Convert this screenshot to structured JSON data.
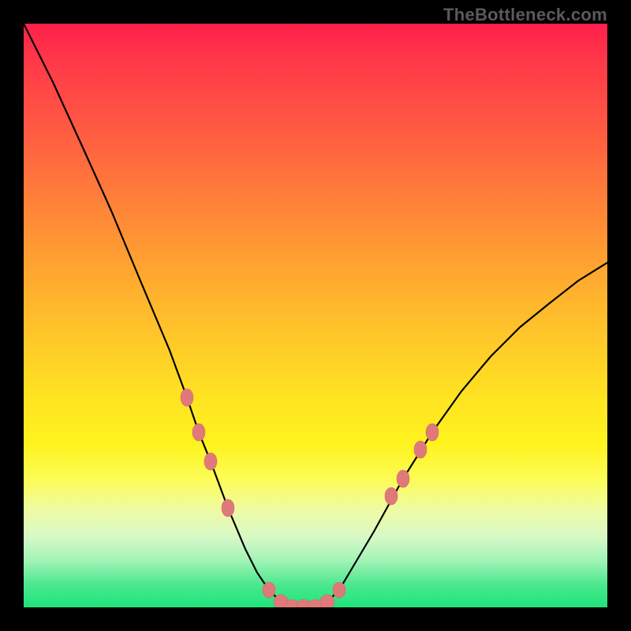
{
  "watermark": {
    "text": "TheBottleneck.com"
  },
  "chart_data": {
    "type": "line",
    "title": "",
    "xlabel": "",
    "ylabel": "",
    "xlim": [
      0,
      100
    ],
    "ylim": [
      0,
      100
    ],
    "grid": false,
    "series": [
      {
        "name": "bottleneck-curve",
        "x": [
          0,
          5,
          10,
          15,
          20,
          25,
          28,
          30,
          32,
          35,
          38,
          40,
          42,
          44,
          46,
          48,
          50,
          52,
          54,
          57,
          60,
          65,
          70,
          75,
          80,
          85,
          90,
          95,
          100
        ],
        "values": [
          100,
          90,
          79,
          68,
          56,
          44,
          36,
          30,
          25,
          17,
          10,
          6,
          3,
          1,
          0,
          0,
          0,
          1,
          3,
          8,
          13,
          22,
          30,
          37,
          43,
          48,
          52,
          56,
          59
        ]
      }
    ],
    "markers": {
      "name": "highlight-points",
      "color": "#e07a7a",
      "x": [
        28,
        30,
        32,
        35,
        42,
        44,
        46,
        48,
        50,
        52,
        54,
        63,
        65,
        68,
        70
      ],
      "values": [
        36,
        30,
        25,
        17,
        3,
        1,
        0,
        0,
        0,
        1,
        3,
        19,
        22,
        27,
        30
      ]
    },
    "gradient_stops": [
      {
        "pct": 0,
        "color": "#ff1f4b"
      },
      {
        "pct": 18,
        "color": "#ff5a42"
      },
      {
        "pct": 42,
        "color": "#ffa530"
      },
      {
        "pct": 64,
        "color": "#ffe322"
      },
      {
        "pct": 83,
        "color": "#f0fba0"
      },
      {
        "pct": 96,
        "color": "#4de88f"
      },
      {
        "pct": 100,
        "color": "#1ee47a"
      }
    ]
  }
}
